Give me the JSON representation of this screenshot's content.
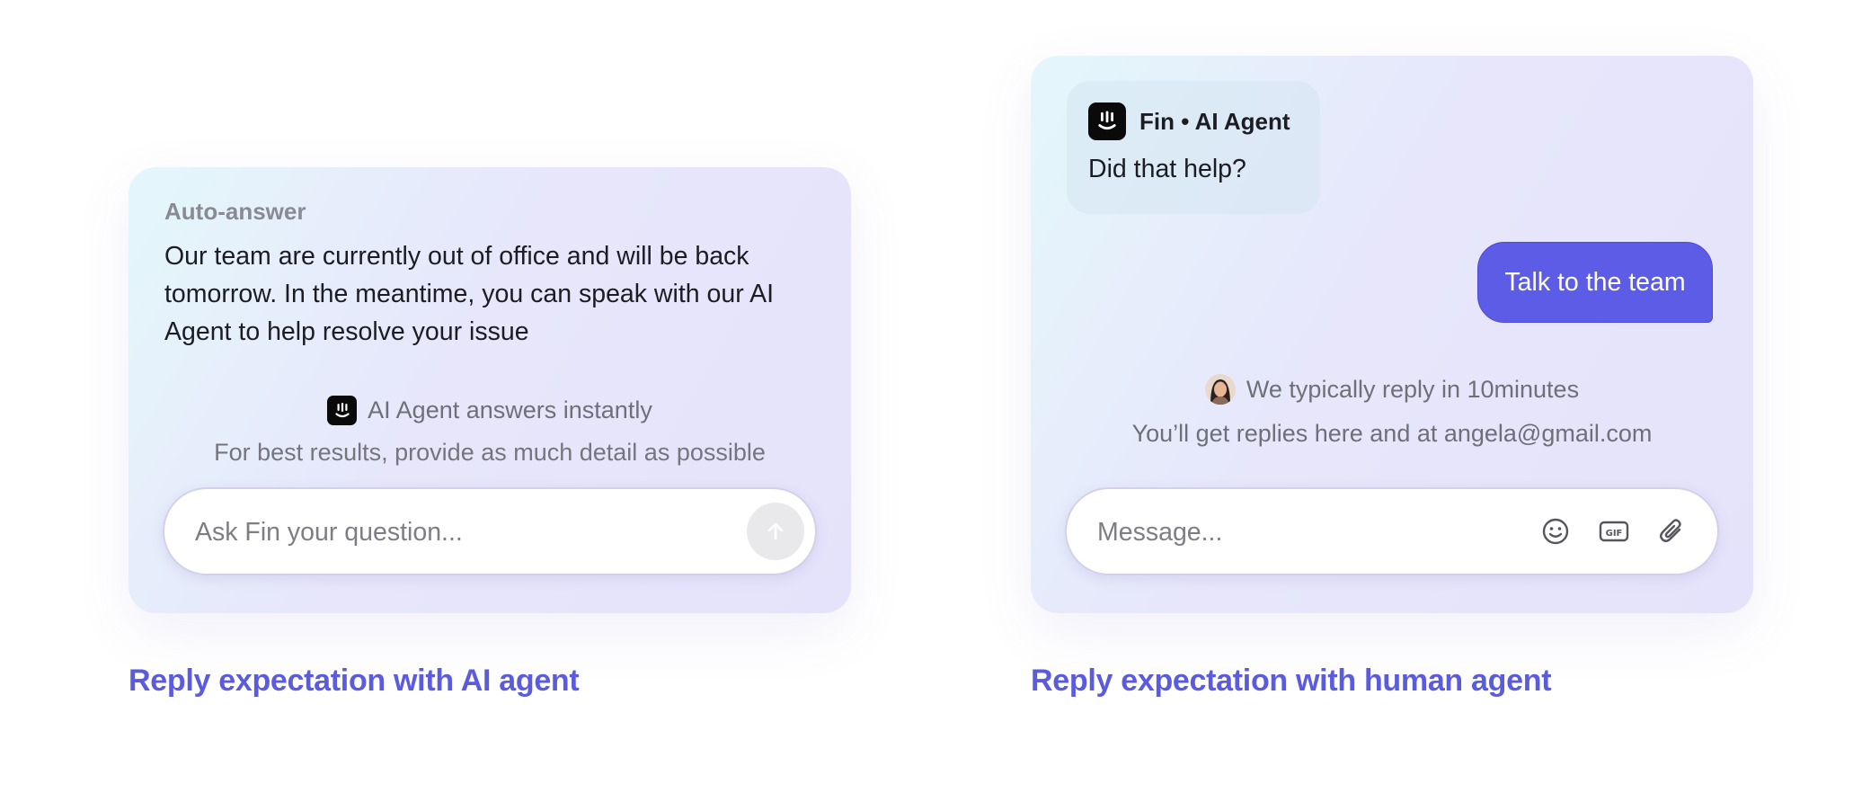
{
  "left_card": {
    "title": "Auto-answer",
    "body": "Our team are currently out of office and will be back tomorrow. In the meantime, you can speak with our AI Agent to help resolve your issue",
    "ai_line": "AI Agent answers instantly",
    "hint": "For best results, provide as much detail as possible",
    "input_placeholder": "Ask Fin your question...",
    "input_value": ""
  },
  "right_card": {
    "sender_name": "Fin • AI Agent",
    "bot_message": "Did that help?",
    "talk_button": "Talk to the team",
    "reply_time": "We typically reply in 10minutes",
    "email_note": "You’ll get replies here and at angela@gmail.com",
    "input_placeholder": "Message...",
    "input_value": ""
  },
  "captions": {
    "left": "Reply expectation with AI agent",
    "right": "Reply expectation with human agent"
  },
  "icons": {
    "logo": "fin-logo-icon",
    "send": "arrow-up-icon",
    "emoji": "smiley-icon",
    "gif": "gif-icon",
    "attach": "paperclip-icon",
    "avatar": "agent-avatar"
  },
  "colors": {
    "accent": "#5b5bde",
    "button": "#5c5ce6",
    "muted_text": "#6f6f78",
    "card_gradient_start": "#e4f7fb",
    "card_gradient_end": "#e5e3fb"
  }
}
